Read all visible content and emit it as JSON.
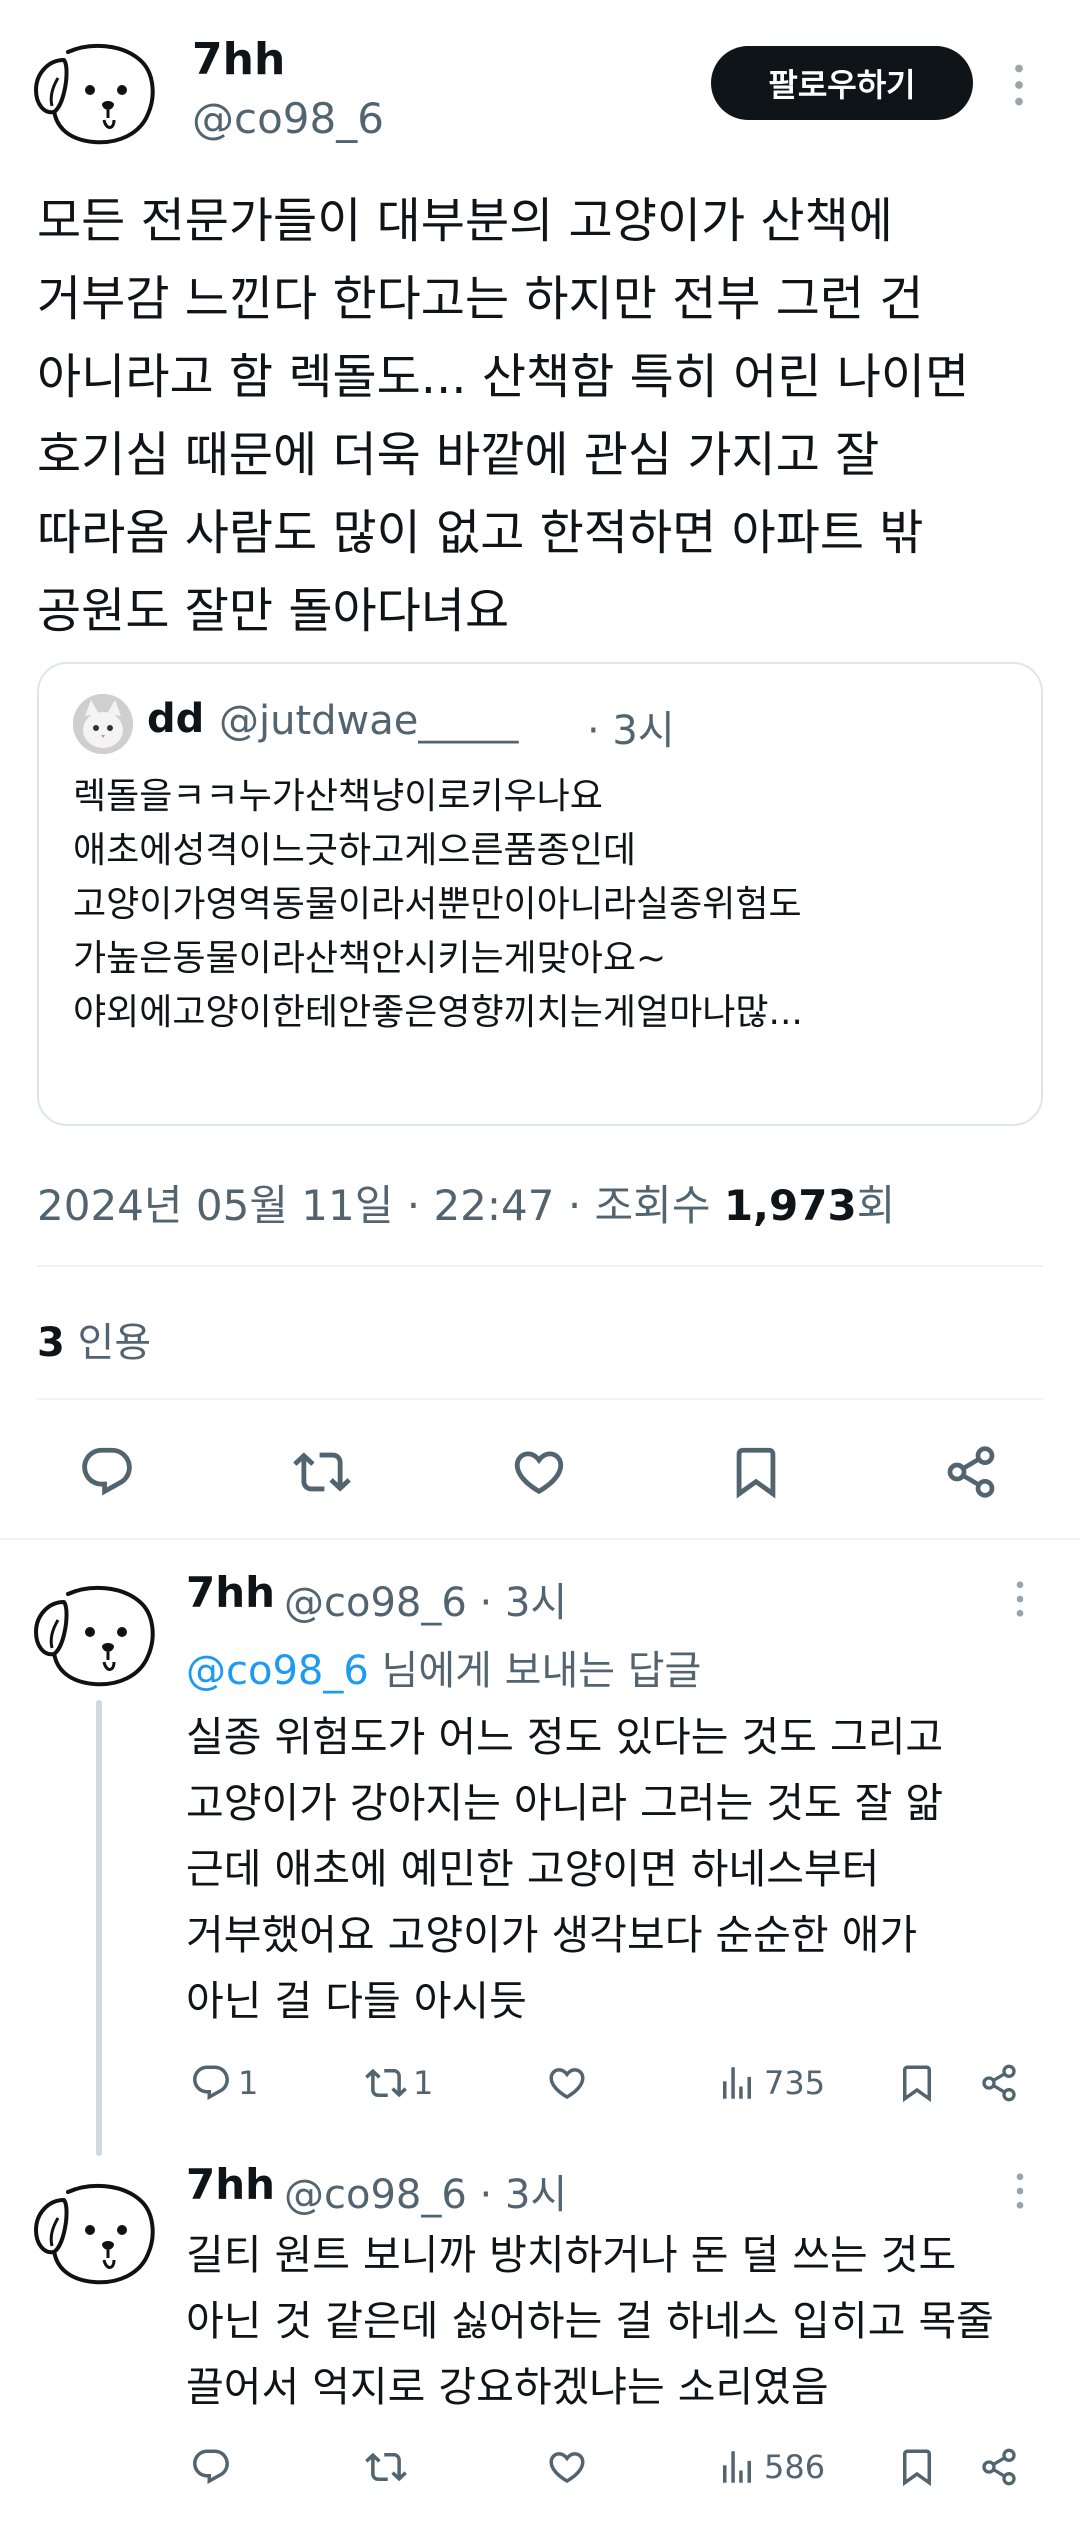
{
  "main_tweet": {
    "name": "7hh",
    "handle": "@co98_6",
    "follow_label": "팔로우하기",
    "body": "모든 전문가들이 대부분의 고양이가 산책에\n거부감 느낀다 한다고는 하지만 전부 그런 건\n아니라고 함 렉돌도... 산책함 특히 어린 나이면\n호기심 때문에 더욱 바깥에 관심 가지고 잘\n따라옴 사람도 많이 없고 한적하면 아파트 밖\n공원도 잘만 돌아다녀요",
    "quote": {
      "name": "dd",
      "handle": "@jutdwae_____",
      "time": "· 3시",
      "lines": [
        "렉돌을ㅋㅋ누가산책냥이로키우나요",
        "애초에성격이느긋하고게으른품종인데",
        "고양이가영역동물이라서뿐만이아니라실종위험도",
        "가높은동물이라산책안시키는게맞아요~",
        "야외에고양이한테안좋은영향끼치는게얼마나많..."
      ]
    },
    "date": "2024년 05월 11일 · 22:47 · 조회수 ",
    "views": "1,973",
    "views_suffix": "회",
    "quotes_count": "3",
    "quotes_label": " 인용"
  },
  "replies": [
    {
      "name": "7hh",
      "handle": "@co98_6 · 3시",
      "reply_to_handle": "@co98_6",
      "reply_to_suffix": " 님에게 보내는 답글",
      "body": "실종 위험도가 어느 정도 있다는 것도 그리고\n고양이가 강아지는 아니라 그러는 것도 잘 앎\n근데 애초에 예민한 고양이면 하네스부터\n거부했어요 고양이가 생각보다 순순한 애가\n아닌 걸 다들 아시듯",
      "reply_count": "1",
      "retweet_count": "1",
      "views": "735"
    },
    {
      "name": "7hh",
      "handle": "@co98_6 · 3시",
      "body": "길티 원트 보니까 방치하거나 돈 덜 쓰는 것도\n아닌 것 같은데 싫어하는 걸 하네스 입히고 목줄\n끌어서 억지로 강요하겠냐는 소리였음",
      "views": "586"
    }
  ],
  "icons": [
    "dog-avatar",
    "more-icon",
    "cat-avatar",
    "reply-icon",
    "retweet-icon",
    "like-icon",
    "bookmark-icon",
    "share-icon",
    "views-icon"
  ]
}
